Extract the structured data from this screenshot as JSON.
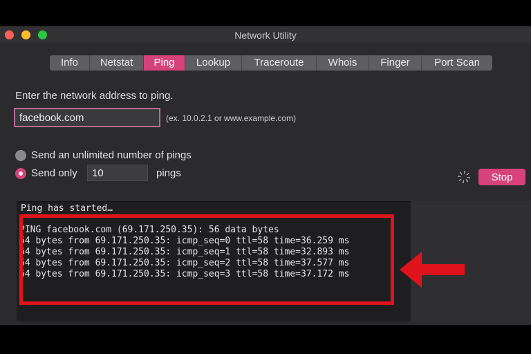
{
  "window": {
    "title": "Network Utility"
  },
  "tabs": [
    {
      "label": "Info",
      "active": false
    },
    {
      "label": "Netstat",
      "active": false
    },
    {
      "label": "Ping",
      "active": true
    },
    {
      "label": "Lookup",
      "active": false
    },
    {
      "label": "Traceroute",
      "active": false
    },
    {
      "label": "Whois",
      "active": false
    },
    {
      "label": "Finger",
      "active": false
    },
    {
      "label": "Port Scan",
      "active": false
    }
  ],
  "ping": {
    "prompt": "Enter the network address to ping.",
    "address_value": "facebook.com",
    "address_hint": "(ex. 10.0.2.1 or www.example.com)",
    "unlimited_label": "Send an unlimited number of pings",
    "send_only_label": "Send only",
    "count_value": "10",
    "pings_label": "pings",
    "stop_label": "Stop",
    "selected_option": "send_only"
  },
  "output": {
    "status": "Ping has started…",
    "lines": [
      "PING facebook.com (69.171.250.35): 56 data bytes",
      "64 bytes from 69.171.250.35: icmp_seq=0 ttl=58 time=36.259 ms",
      "64 bytes from 69.171.250.35: icmp_seq=1 ttl=58 time=32.893 ms",
      "64 bytes from 69.171.250.35: icmp_seq=2 ttl=58 time=37.577 ms",
      "64 bytes from 69.171.250.35: icmp_seq=3 ttl=58 time=37.172 ms"
    ]
  },
  "colors": {
    "accent": "#d6437a",
    "annotation": "#e0121c"
  },
  "icons": {
    "spinner": "activity-spinner-icon",
    "annotation_arrow": "left-arrow-icon"
  }
}
